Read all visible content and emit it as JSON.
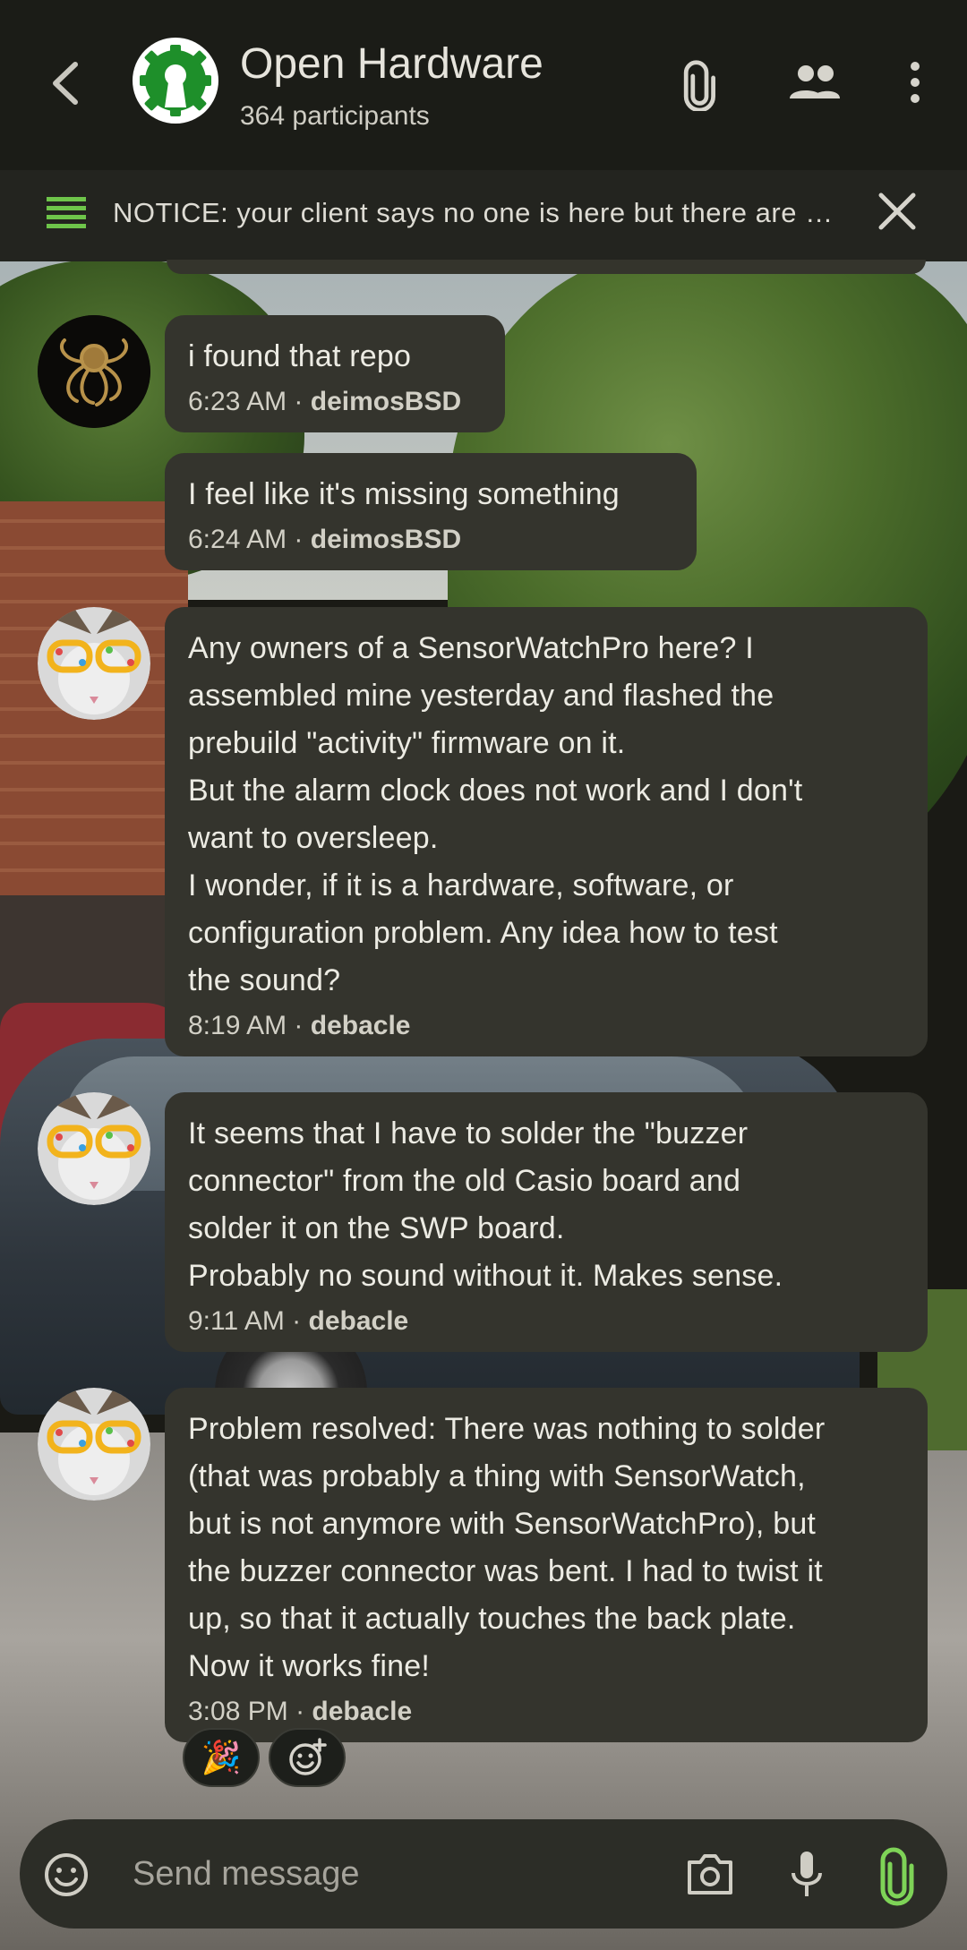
{
  "header": {
    "room_name": "Open Hardware",
    "participants": "364 participants"
  },
  "notice": {
    "text": "NOTICE: your client says no one is here but there are many people here"
  },
  "messages": [
    {
      "body": "i found that repo",
      "time": "6:23 AM",
      "sender": "deimosBSD"
    },
    {
      "body": "I feel like it's missing something",
      "time": "6:24 AM",
      "sender": "deimosBSD"
    },
    {
      "body": "Any owners of a SensorWatchPro here? I\nassembled mine yesterday and flashed the\nprebuild \"activity\" firmware on it.\nBut the alarm clock does not work and I don't\nwant to oversleep.\nI wonder, if it is a hardware, software, or\nconfiguration problem. Any idea how to test\nthe sound?",
      "time": "8:19 AM",
      "sender": "debacle"
    },
    {
      "body": "It seems that I have to solder the \"buzzer\nconnector\" from the old Casio board and\nsolder it on the SWP board.\nProbably no sound without it. Makes sense.",
      "time": "9:11 AM",
      "sender": "debacle"
    },
    {
      "body": "Problem resolved: There was nothing to solder\n(that was probably a thing with SensorWatch,\nbut is not anymore with SensorWatchPro), but\nthe buzzer connector was bent. I had to twist it\nup, so that it actually touches the back plate.\nNow it works fine!",
      "time": "3:08 PM",
      "sender": "debacle"
    }
  ],
  "meta_separator": " · ",
  "reactions": [
    {
      "emoji": "🎉"
    }
  ],
  "composer": {
    "placeholder": "Send message"
  },
  "colors": {
    "header_bg": "#1b1c17",
    "bubble_bg": "#34342d",
    "accent_green": "#6ec54a",
    "text": "#ecebe3"
  },
  "icons": [
    "back-arrow-icon",
    "attachment-icon",
    "people-icon",
    "more-vert-icon",
    "list-icon",
    "close-icon",
    "emoji-icon",
    "camera-icon",
    "mic-icon",
    "add-reaction-icon"
  ]
}
